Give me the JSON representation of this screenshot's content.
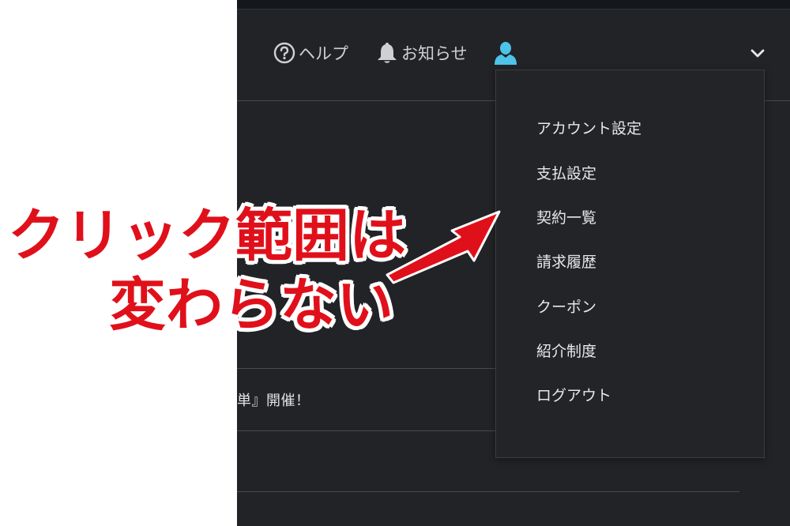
{
  "header": {
    "help_label": "ヘルプ",
    "notice_label": "お知らせ",
    "icons": [
      "question-circle-icon",
      "bell-icon",
      "user-icon",
      "chevron-down-icon"
    ],
    "user_icon_color": "#4ec3e8"
  },
  "content": {
    "notice_fragment": "単』開催！"
  },
  "menu": {
    "items": [
      {
        "label": "アカウント設定"
      },
      {
        "label": "支払設定"
      },
      {
        "label": "契約一覧"
      },
      {
        "label": "請求履歴"
      },
      {
        "label": "クーポン"
      },
      {
        "label": "紹介制度"
      },
      {
        "label": "ログアウト"
      }
    ]
  },
  "annotation": {
    "line1": "クリック範囲は",
    "line2": "変わらない",
    "color": "#e0101b"
  }
}
